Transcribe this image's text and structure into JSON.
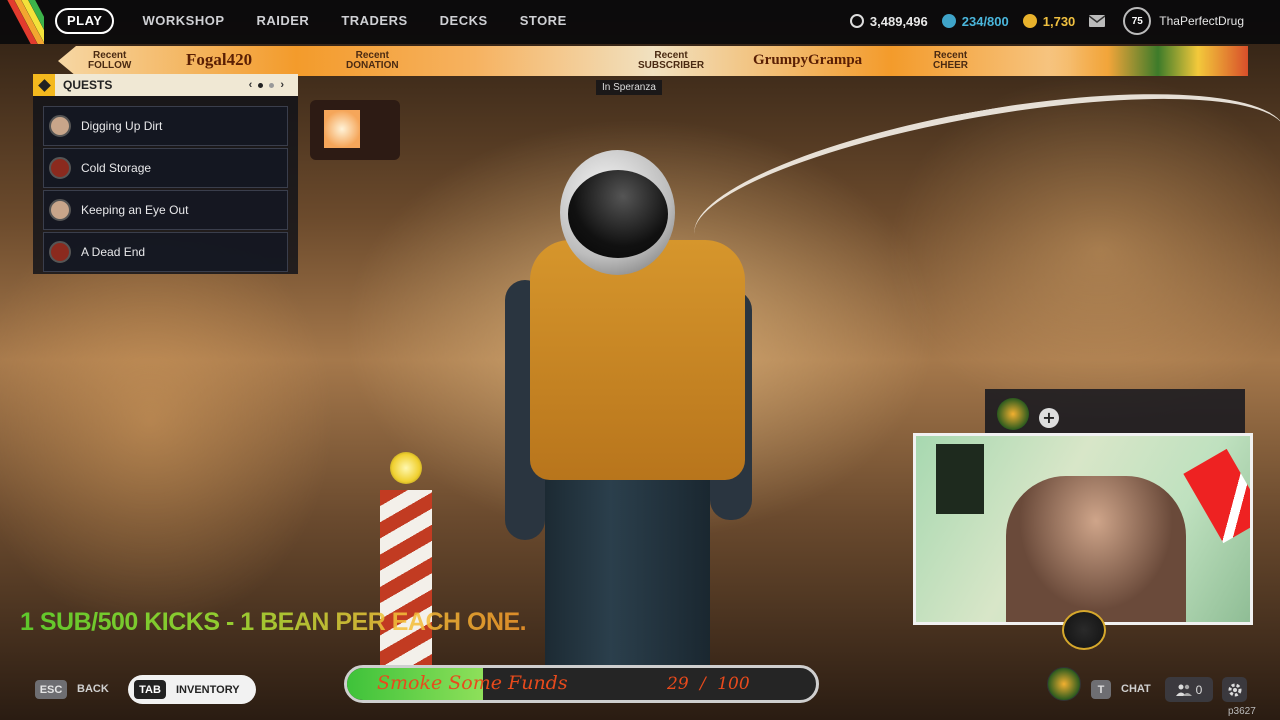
{
  "nav": {
    "play": "PLAY",
    "workshop": "WORKSHOP",
    "raider": "RAIDER",
    "traders": "TRADERS",
    "decks": "DECKS",
    "store": "STORE"
  },
  "currencies": {
    "coins": "3,489,496",
    "tokens": "234/800",
    "credits": "1,730"
  },
  "player": {
    "level": "75",
    "username": "ThaPerfectDrug"
  },
  "ticker": {
    "follow_top": "Recent",
    "follow_bottom": "FOLLOW",
    "follow_name": "Fogal420",
    "donation_top": "Recent",
    "donation_bottom": "DONATION",
    "subscriber_top": "Recent",
    "subscriber_bottom": "SUBSCRIBER",
    "subscriber_name": "GrumpyGrampa",
    "cheer_top": "Recent",
    "cheer_bottom": "CHEER"
  },
  "quests": {
    "title": "QUESTS",
    "items": [
      {
        "label": "Digging Up Dirt"
      },
      {
        "label": "Cold Storage"
      },
      {
        "label": "Keeping an Eye Out"
      },
      {
        "label": "A Dead End"
      }
    ]
  },
  "location": "In Speranza",
  "promo": "1 SUB/500 KICKS - 1 BEAN PER EACH ONE.",
  "bottom": {
    "esc_key": "ESC",
    "back": "BACK",
    "tab_key": "TAB",
    "inventory": "INVENTORY",
    "t_key": "T",
    "chat": "CHAT",
    "friends_count": "0",
    "build": "p3627"
  },
  "fund": {
    "name": "Smoke Some Funds",
    "current": "29",
    "separator": "/",
    "goal": "100",
    "progress": 0.29
  },
  "colors": {
    "accent": "#f4b91e",
    "fund_fill": "#3ec23a",
    "fund_text": "#e84a1c",
    "ticker_orange": "#f39b2b"
  }
}
